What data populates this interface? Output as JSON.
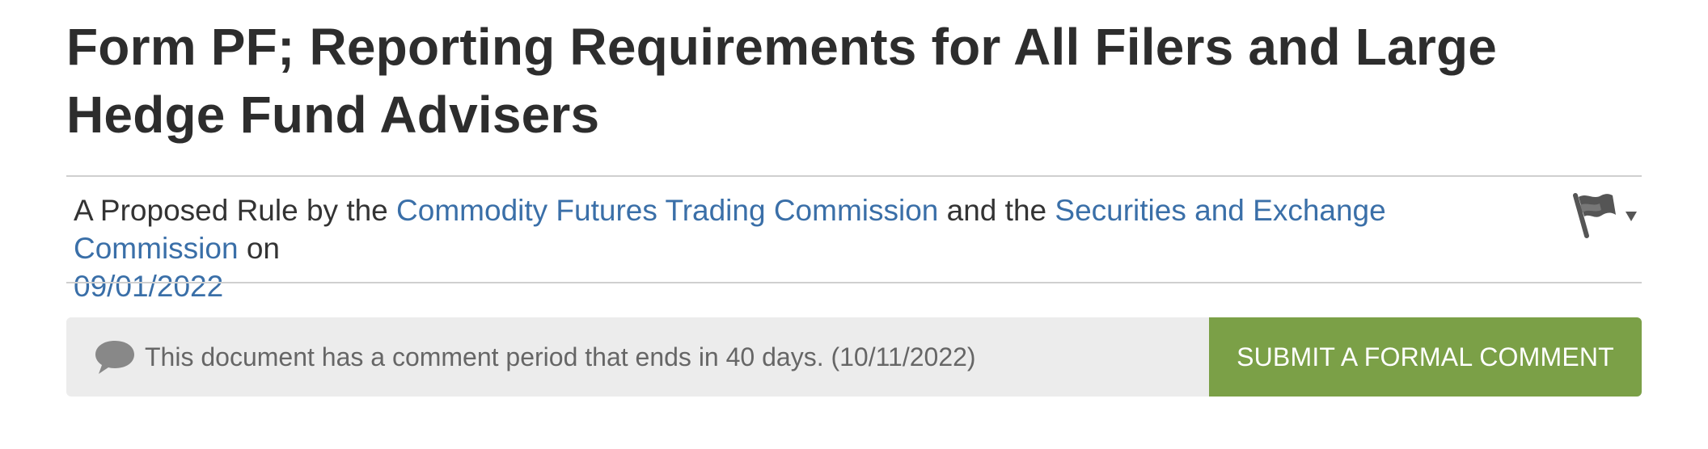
{
  "document": {
    "title": "Form PF; Reporting Requirements for All Filers and Large Hedge Fund Advisers",
    "byline": {
      "prefix": "A Proposed Rule by the ",
      "agency_1": "Commodity Futures Trading Commission",
      "connector": " and the ",
      "agency_2": "Securities and Exchange Commission",
      "on_text": " on ",
      "date": "09/01/2022"
    },
    "flag_menu": {
      "icon": "flag-icon",
      "caret": "▼"
    }
  },
  "comment_banner": {
    "icon": "speech-bubble-icon",
    "text": "This document has a comment period that ends in 40 days. (10/11/2022)",
    "button_label": "SUBMIT A FORMAL COMMENT"
  },
  "colors": {
    "link": "#3a6fa8",
    "banner_bg": "#ececec",
    "button_bg": "#7ba047",
    "title": "#2d2d2d"
  }
}
